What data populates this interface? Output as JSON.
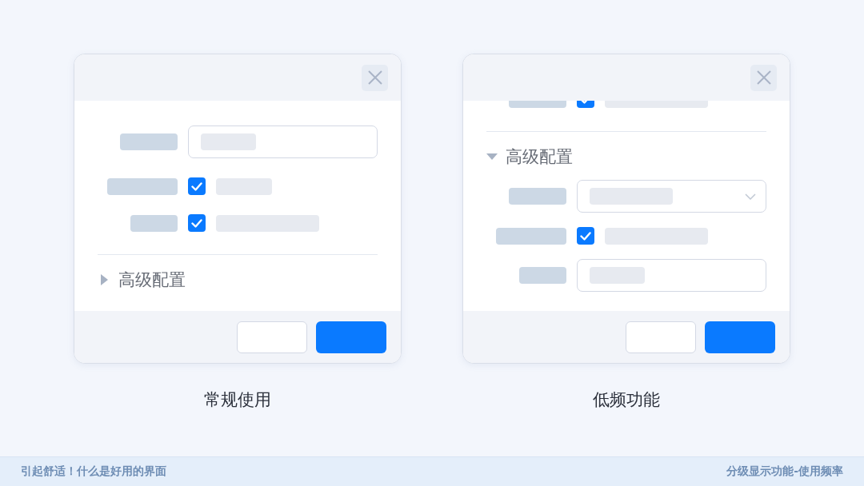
{
  "dialogs": [
    {
      "scrolled": false,
      "rows": [
        {
          "kind": "input"
        },
        {
          "kind": "checkbox",
          "checked": true
        },
        {
          "kind": "checkbox",
          "checked": true
        }
      ],
      "section": {
        "title": "高级配置",
        "expanded": false
      },
      "caption": "常规使用"
    },
    {
      "scrolled": true,
      "rows": [
        {
          "kind": "checkbox",
          "checked": true
        }
      ],
      "section": {
        "title": "高级配置",
        "expanded": true,
        "rows": [
          {
            "kind": "select"
          },
          {
            "kind": "checkbox",
            "checked": true
          },
          {
            "kind": "input"
          }
        ]
      },
      "caption": "低频功能"
    }
  ],
  "footer": {
    "left": "引起舒适！什么是好用的界面",
    "right": "分级显示功能-使用频率"
  }
}
